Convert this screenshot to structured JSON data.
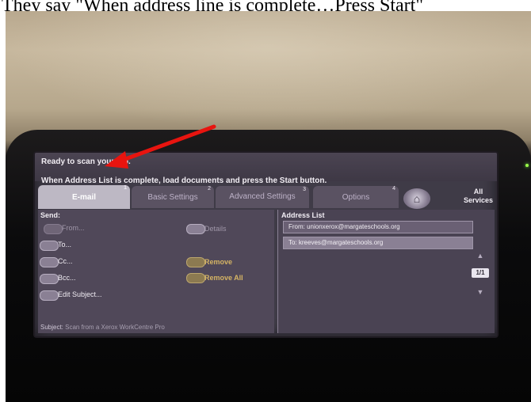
{
  "caption": "They say \"When address line is complete…Press Start\"",
  "screen": {
    "status_text": "Ready to scan your job.",
    "instruction": "When Address List is complete, load documents and press the Start button.",
    "tabs": [
      {
        "label": "E-mail",
        "number": "1"
      },
      {
        "label": "Basic Settings",
        "number": "2"
      },
      {
        "label": "Advanced Settings",
        "number": "3"
      },
      {
        "label": "Options",
        "number": "4"
      }
    ],
    "all_services": "All Services",
    "send_label": "Send:",
    "buttons": {
      "from": "From...",
      "to": "To...",
      "cc": "Cc...",
      "bcc": "Bcc...",
      "edit_subject": "Edit Subject...",
      "details": "Details",
      "remove": "Remove",
      "remove_all": "Remove All"
    },
    "subject_label": "Subject:",
    "subject_value": "Scan from a Xerox WorkCentre Pro",
    "address_list_title": "Address List",
    "addresses": [
      "From: unionxerox@margateschools.org",
      "To: kreeves@margateschools.org"
    ],
    "page_indicator": "1/1"
  },
  "colors": {
    "arrow": "#e8140f",
    "led": "#9cff4a",
    "disabled_orange": "#d5b464"
  }
}
